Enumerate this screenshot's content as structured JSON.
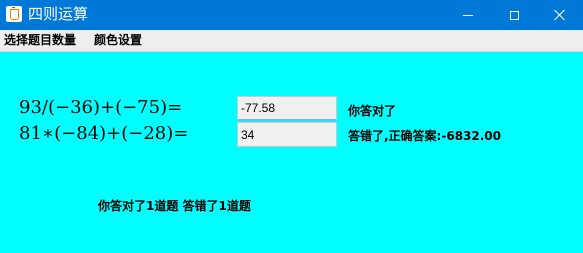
{
  "window": {
    "title": "四则运算",
    "app_icon": "java-icon",
    "controls": [
      "minimize-icon",
      "maximize-icon",
      "close-icon"
    ],
    "titlebar_color": "#0078d7"
  },
  "menubar": {
    "items": [
      {
        "label": "选择题目数量"
      },
      {
        "label": "颜色设置"
      }
    ]
  },
  "main": {
    "background_color": "#00ffff",
    "questions": [
      {
        "expression": "93/(−36)+(−75)=",
        "answer": "-77.58",
        "feedback": "你答对了"
      },
      {
        "expression": "81∗(−84)+(−28)=",
        "answer": "34",
        "feedback": "答错了,正确答案:-6832.00"
      }
    ],
    "summary": "你答对了1道题  答错了1道题"
  }
}
